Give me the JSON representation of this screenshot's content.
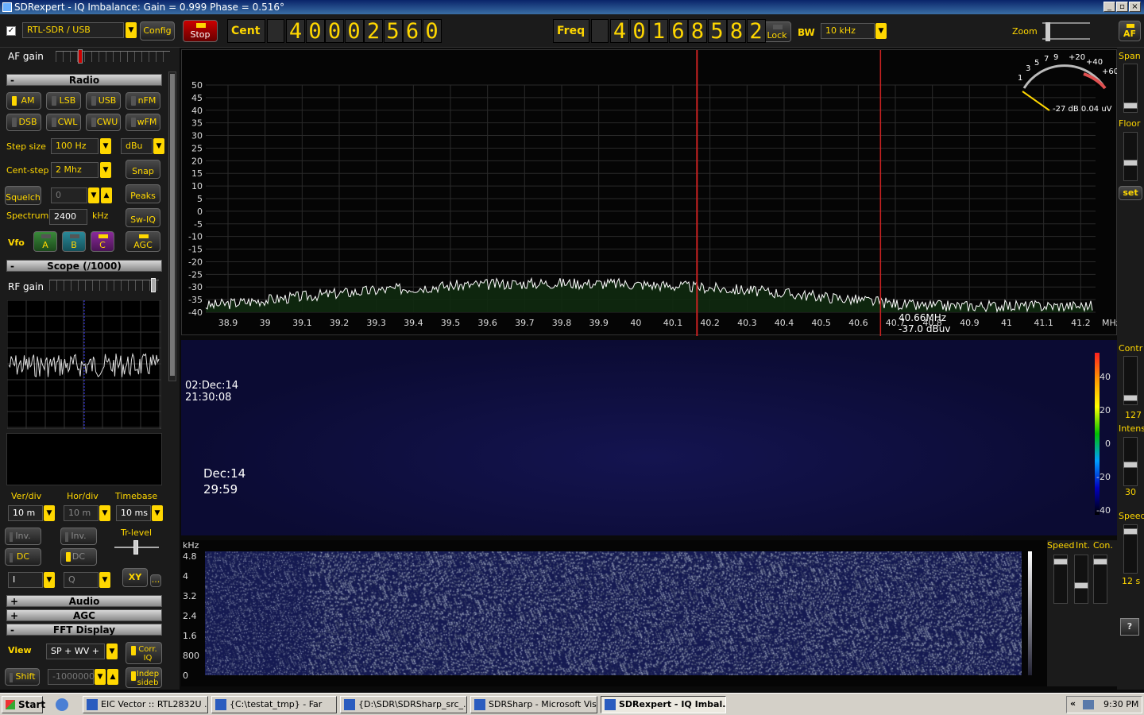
{
  "window": {
    "title": "SDRexpert - IQ Imbalance: Gain = 0.999 Phase = 0.516°",
    "min": "_",
    "max": "▫",
    "close": "×"
  },
  "top": {
    "device": "RTL-SDR / USB",
    "config": "Config",
    "stop": "Stop",
    "cent_label": "Cent",
    "cent_digits": [
      "4",
      "0",
      "0",
      "0",
      "2",
      "5",
      "6",
      "0"
    ],
    "freq_label": "Freq",
    "freq_digits": [
      "4",
      "0",
      "1",
      "6",
      "8",
      "5",
      "8",
      "2"
    ],
    "lock": "Lock",
    "bw_label": "BW",
    "bw_value": "10 kHz",
    "zoom_label": "Zoom",
    "af": "AF"
  },
  "left": {
    "af_gain": "AF gain",
    "radio_header": "Radio",
    "collapse": "-",
    "expand": "+",
    "modes": [
      "AM",
      "LSB",
      "USB",
      "nFM",
      "DSB",
      "CWL",
      "CWU",
      "wFM"
    ],
    "step_size_label": "Step size",
    "step_size": "100 Hz",
    "unit": "dBu",
    "cent_step_label": "Cent-step",
    "cent_step": "2 Mhz",
    "snap": "Snap",
    "squelch": "Squelch",
    "squelch_value": "0",
    "peaks": "Peaks",
    "spectrum_label": "Spectrum",
    "spectrum_value": "2400",
    "khz": "kHz",
    "swiq": "Sw-IQ",
    "vfo": "Vfo",
    "vfo_a": "A",
    "vfo_b": "B",
    "vfo_c": "C",
    "agc_btn": "AGC",
    "scope_header": "Scope (/1000)",
    "rf_gain": "RF gain",
    "ver_div_label": "Ver/div",
    "hor_div_label": "Hor/div",
    "timebase_label": "Timebase",
    "ver_div": "10 m",
    "hor_div": "10 m",
    "timebase": "10 ms",
    "inv1": "Inv.",
    "inv2": "Inv.",
    "trlevel": "Tr-level",
    "dc1": "DC",
    "dc2": "DC",
    "chan1": "I",
    "chan2": "Q",
    "xy": "XY",
    "dots": "...",
    "audio_header": "Audio",
    "agc_header": "AGC",
    "fft_header": "FFT Display",
    "view_label": "View",
    "view_value": "SP + WV +",
    "corr": "Corr. IQ",
    "shift": "Shift",
    "shift_value": "-1000000",
    "indep": "Indep sideb"
  },
  "right": {
    "span": "Span",
    "floor": "Floor",
    "set": "set",
    "contr": "Contr",
    "contr_val": "127",
    "intens": "Intens",
    "intens_val": "30",
    "speed": "Speed",
    "speed_val": "12 s",
    "help": "?"
  },
  "spectrum": {
    "y_ticks": [
      "50",
      "45",
      "40",
      "35",
      "30",
      "25",
      "20",
      "15",
      "10",
      "5",
      "0",
      "-5",
      "-10",
      "-15",
      "-20",
      "-25",
      "-30",
      "-35",
      "-40"
    ],
    "x_ticks": [
      "38.9",
      "39",
      "39.1",
      "39.2",
      "39.3",
      "39.4",
      "39.5",
      "39.6",
      "39.7",
      "39.8",
      "39.9",
      "40",
      "40.1",
      "40.2",
      "40.3",
      "40.4",
      "40.5",
      "40.6",
      "40.7",
      "40.8",
      "40.9",
      "41",
      "41.1",
      "41.2"
    ],
    "x_unit": "MHz",
    "cursor_freq": "40.66MHz",
    "cursor_level": "-37.0 dBuv",
    "meter_scale": [
      "1",
      "3",
      "5",
      "7",
      "9",
      "+20",
      "+40",
      "+60"
    ],
    "meter_reading": "-27 dB 0.04 uV",
    "trace_color": "#ffffff",
    "marker_color": "#cc2222"
  },
  "waterfall": {
    "date1": "02:Dec:14",
    "time1": "21:30:08",
    "date2": "Dec:14",
    "time2": "29:59",
    "scale": [
      "40",
      "20",
      "0",
      "-20",
      "-40"
    ]
  },
  "specgram": {
    "unit": "kHz",
    "y_ticks": [
      "4.8",
      "4",
      "3.2",
      "2.4",
      "1.6",
      "800",
      "0"
    ],
    "speed": "Speed",
    "int": "Int.",
    "con": "Con."
  },
  "taskbar": {
    "start": "Start",
    "tasks": [
      "EIC Vector :: RTL2832U ...",
      "{C:\\testat_tmp} - Far",
      "{D:\\SDR\\SDRSharp_src_...",
      "SDRSharp - Microsoft Vis...",
      "SDRexpert - IQ Imbal..."
    ],
    "chev": "«",
    "clock": "9:30 PM"
  }
}
